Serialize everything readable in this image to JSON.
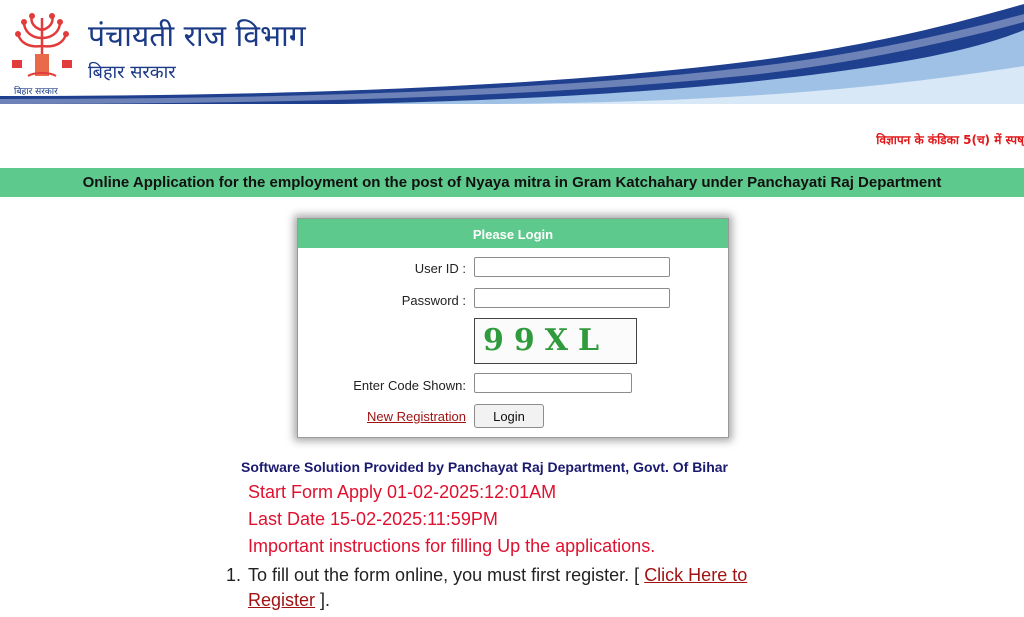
{
  "header": {
    "department_hi": "पंचायती राज विभाग",
    "state_hi": "बिहार सरकार",
    "emblem_caption": "बिहार सरकार",
    "colors": {
      "wave_dark": "#1f3f8f",
      "wave_light": "#9fc1e6",
      "text": "#1c3b86"
    }
  },
  "notice": {
    "text": "विज्ञापन के कंडिका 5(च) में स्पष्"
  },
  "banner": {
    "title": "Online Application for the employment on the post of Nyaya mitra in Gram Katchahary under Panchayati Raj Department"
  },
  "login": {
    "heading": "Please Login",
    "user_id_label": "User ID :",
    "password_label": "Password :",
    "captcha_text": "99XL",
    "code_label": "Enter Code Shown:",
    "new_registration_label": "New Registration",
    "login_button_label": "Login"
  },
  "footer": {
    "credit": "Software Solution Provided by Panchayat Raj Department, Govt. Of Bihar",
    "start_date": "Start Form Apply 01-02-2025:12:01AM",
    "last_date": "Last Date 15-02-2025:11:59PM",
    "instructions_heading": "Important instructions for filling Up the applications.",
    "instructions": [
      {
        "number": "1.",
        "text": "To fill out the form online, you must first register. [",
        "link": "Click Here to Register",
        "tail": "]."
      }
    ]
  },
  "colors": {
    "accent_green": "#5ec98c",
    "alert_red": "#e0102f",
    "link_red": "#a11313",
    "navy": "#1a1a6e"
  }
}
